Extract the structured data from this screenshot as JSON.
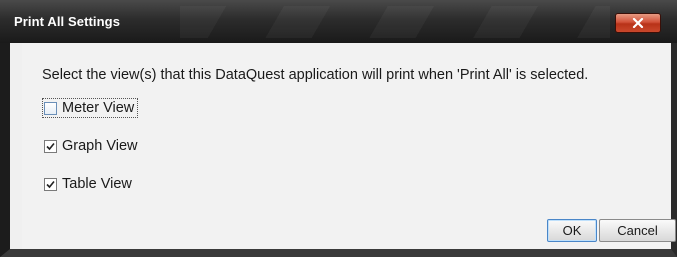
{
  "window": {
    "title": "Print All Settings",
    "close_icon": "close-icon"
  },
  "main": {
    "description": "Select the view(s) that this DataQuest application will print when 'Print All' is selected.",
    "options": [
      {
        "label": "Meter View",
        "checked": false,
        "focused": true
      },
      {
        "label": "Graph View",
        "checked": true,
        "focused": false
      },
      {
        "label": "Table View",
        "checked": true,
        "focused": false
      }
    ]
  },
  "buttons": {
    "ok_label": "OK",
    "cancel_label": "Cancel"
  },
  "colors": {
    "titlebar": "#2c2c2c",
    "close_button": "#c9482c",
    "body": "#f2f2f2"
  }
}
